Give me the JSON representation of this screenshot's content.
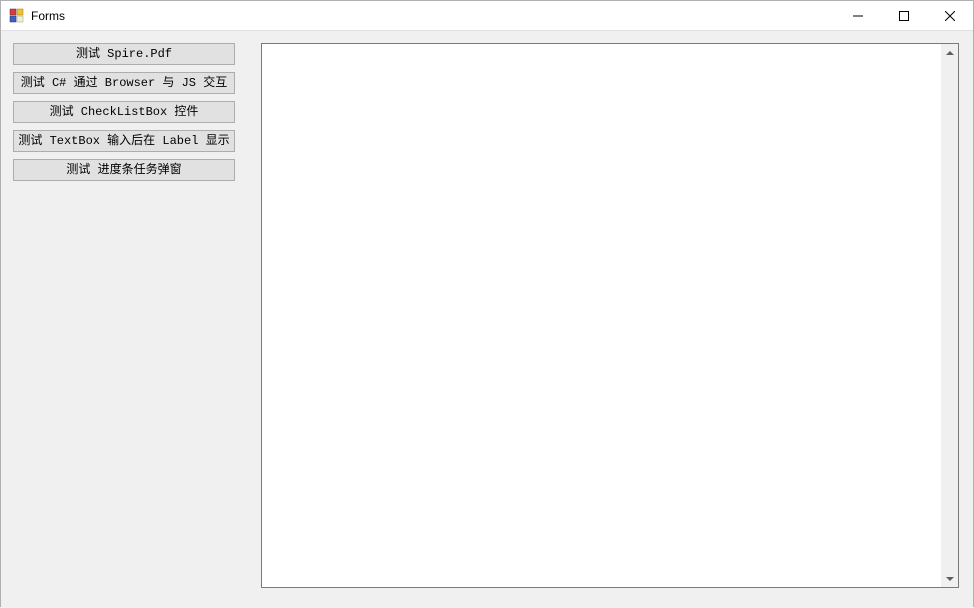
{
  "window": {
    "title": "Forms"
  },
  "buttons": [
    {
      "label": "测试 Spire.Pdf"
    },
    {
      "label": "测试 C# 通过 Browser 与 JS 交互"
    },
    {
      "label": "测试 CheckListBox 控件"
    },
    {
      "label": "测试 TextBox 输入后在 Label 显示"
    },
    {
      "label": "测试 进度条任务弹窗"
    }
  ],
  "textarea": {
    "value": ""
  }
}
